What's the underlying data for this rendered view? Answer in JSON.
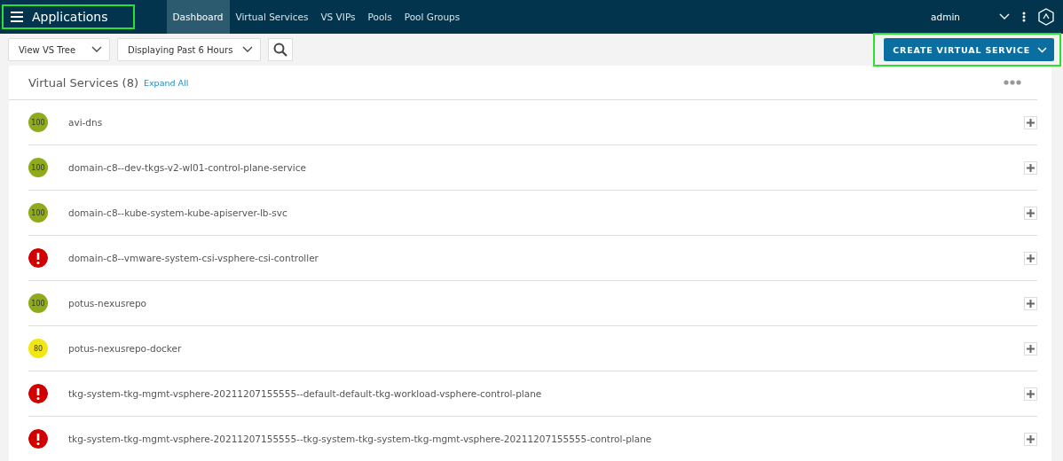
{
  "app": {
    "title": "Applications"
  },
  "nav": [
    {
      "label": "Dashboard",
      "selected": true
    },
    {
      "label": "Virtual Services",
      "selected": false
    },
    {
      "label": "VS VIPs",
      "selected": false
    },
    {
      "label": "Pools",
      "selected": false
    },
    {
      "label": "Pool Groups",
      "selected": false
    }
  ],
  "user": {
    "name": "admin"
  },
  "toolbar": {
    "view": "View VS Tree",
    "range": "Displaying Past 6 Hours",
    "create_button": "CREATE VIRTUAL SERVICE"
  },
  "list": {
    "title": "Virtual Services (8)",
    "expand": "Expand All",
    "rows": [
      {
        "kind": "score",
        "score": "100",
        "color": "#8fab1b",
        "name": "avi-dns"
      },
      {
        "kind": "score",
        "score": "100",
        "color": "#8fab1b",
        "name": "domain-c8--dev-tkgs-v2-wl01-control-plane-service"
      },
      {
        "kind": "score",
        "score": "100",
        "color": "#8fab1b",
        "name": "domain-c8--kube-system-kube-apiserver-lb-svc"
      },
      {
        "kind": "error",
        "color": "#d10000",
        "name": "domain-c8--vmware-system-csi-vsphere-csi-controller"
      },
      {
        "kind": "score",
        "score": "100",
        "color": "#8fab1b",
        "name": "potus-nexusrepo"
      },
      {
        "kind": "score",
        "score": "80",
        "color": "#f2e614",
        "name": "potus-nexusrepo-docker"
      },
      {
        "kind": "error",
        "color": "#d10000",
        "name": "tkg-system-tkg-mgmt-vsphere-20211207155555--default-default-tkg-workload-vsphere-control-plane"
      },
      {
        "kind": "error",
        "color": "#d10000",
        "name": "tkg-system-tkg-mgmt-vsphere-20211207155555--tkg-system-tkg-system-tkg-mgmt-vsphere-20211207155555-control-plane"
      }
    ]
  }
}
